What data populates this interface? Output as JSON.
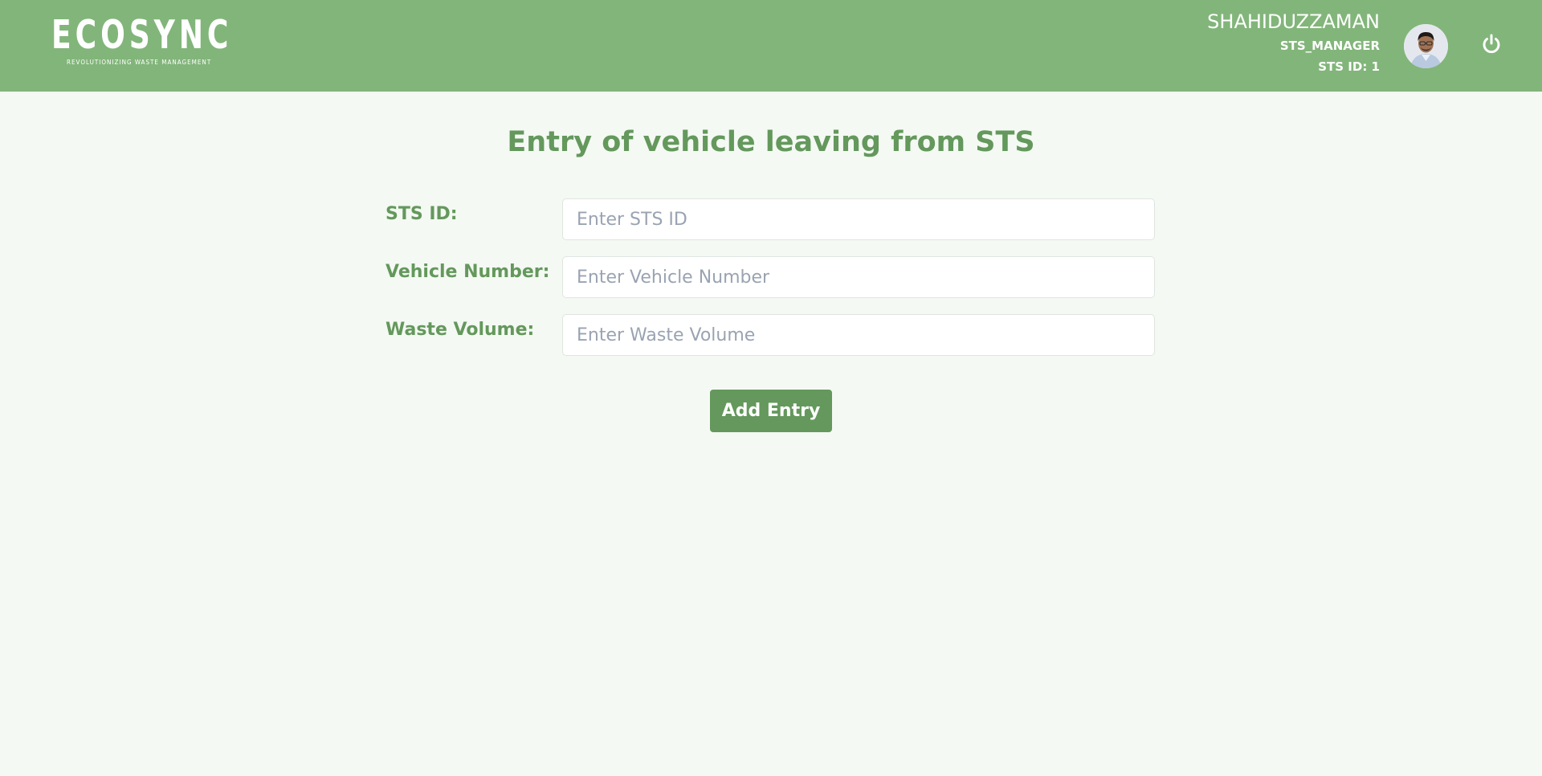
{
  "brand": {
    "name": "ECOSYNC",
    "tagline": "REVOLUTIONIZING WASTE MANAGEMENT"
  },
  "user": {
    "name": "SHAHIDUZZAMAN",
    "role": "STS_MANAGER",
    "sts_id": "STS ID: 1",
    "avatar_icon": "avatar-photo",
    "logout_icon": "power-icon"
  },
  "page": {
    "title": "Entry of vehicle leaving from STS"
  },
  "form": {
    "sts_id": {
      "label": "STS ID:",
      "placeholder": "Enter STS ID",
      "value": ""
    },
    "vehicle_number": {
      "label": "Vehicle Number:",
      "placeholder": "Enter Vehicle Number",
      "value": ""
    },
    "waste_volume": {
      "label": "Waste Volume:",
      "placeholder": "Enter Waste Volume",
      "value": ""
    },
    "submit_label": "Add Entry"
  },
  "colors": {
    "header_bg": "#82b57a",
    "page_bg": "#f4f9f3",
    "accent": "#64985c",
    "placeholder": "#9aa3b2"
  }
}
